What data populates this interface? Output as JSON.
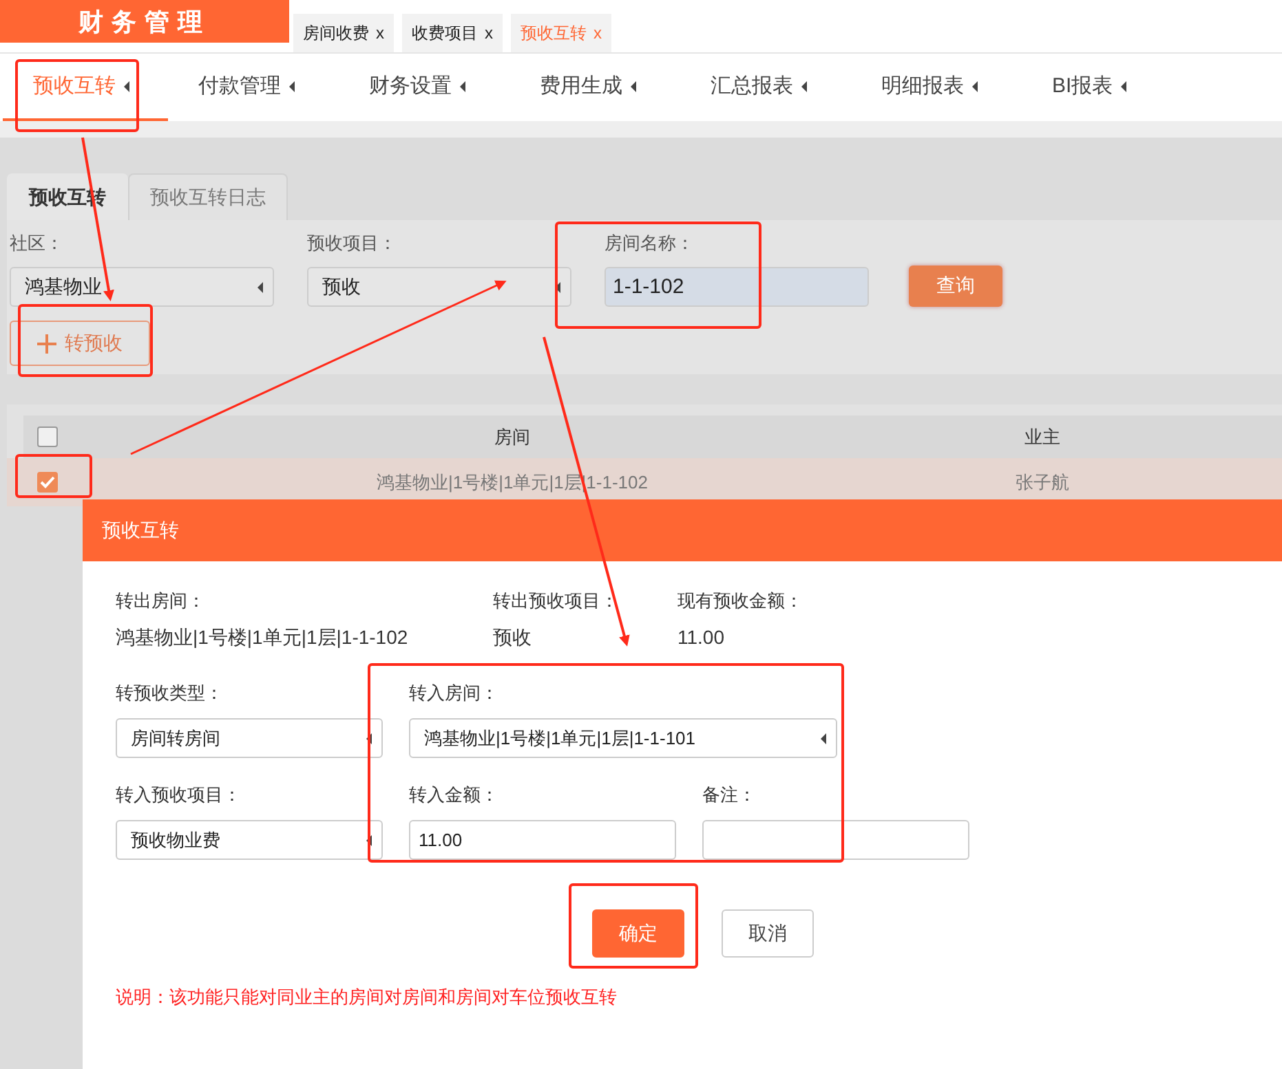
{
  "app": {
    "title": "财务管理"
  },
  "open_tabs": [
    {
      "label": "房间收费",
      "close": "x",
      "selected": false
    },
    {
      "label": "收费项目",
      "close": "x",
      "selected": false
    },
    {
      "label": "预收互转",
      "close": "x",
      "selected": true
    }
  ],
  "menu": [
    {
      "label": "预收互转",
      "selected": true
    },
    {
      "label": "付款管理",
      "selected": false
    },
    {
      "label": "财务设置",
      "selected": false
    },
    {
      "label": "费用生成",
      "selected": false
    },
    {
      "label": "汇总报表",
      "selected": false
    },
    {
      "label": "明细报表",
      "selected": false
    },
    {
      "label": "BI报表",
      "selected": false
    }
  ],
  "sub_tabs": [
    {
      "label": "预收互转",
      "selected": true
    },
    {
      "label": "预收互转日志",
      "selected": false
    }
  ],
  "filters": [
    {
      "label": "社区：",
      "value": "鸿基物业",
      "kind": "select"
    },
    {
      "label": "预收项目：",
      "value": "预收",
      "kind": "select"
    },
    {
      "label": "房间名称：",
      "value": "1-1-102",
      "kind": "input"
    }
  ],
  "search_button": "查询",
  "add_button": "转预收",
  "table": {
    "header_checked": false,
    "columns": [
      "房间",
      "业主"
    ],
    "rows": [
      {
        "checked": true,
        "selected": true,
        "cells": [
          "鸿基物业|1号楼|1单元|1层|1-1-102",
          "张子航"
        ]
      }
    ]
  },
  "dialog": {
    "title": "预收互转",
    "info": [
      {
        "label": "转出房间：",
        "value": "鸿基物业|1号楼|1单元|1层|1-1-102"
      },
      {
        "label": "转出预收项目：",
        "value": "预收"
      },
      {
        "label": "现有预收金额：",
        "value": "11.00"
      }
    ],
    "field_rows": [
      [
        {
          "label": "转预收类型：",
          "value": "房间转房间",
          "kind": "select",
          "wide": false
        },
        {
          "label": "转入房间：",
          "value": "鸿基物业|1号楼|1单元|1层|1-1-101",
          "kind": "select",
          "wide": true
        }
      ],
      [
        {
          "label": "转入预收项目：",
          "value": "预收物业费",
          "kind": "select",
          "wide": false
        },
        {
          "label": "转入金额：",
          "value": "11.00",
          "kind": "input",
          "wide": false
        },
        {
          "label": "备注：",
          "kind": "input",
          "wide": false
        }
      ]
    ],
    "buttons": [
      {
        "label": "确定",
        "kind": "primary"
      },
      {
        "label": "取消",
        "kind": "default"
      }
    ],
    "note": "说明：该功能只能对同业主的房间对房间和房间对车位预收互转"
  }
}
